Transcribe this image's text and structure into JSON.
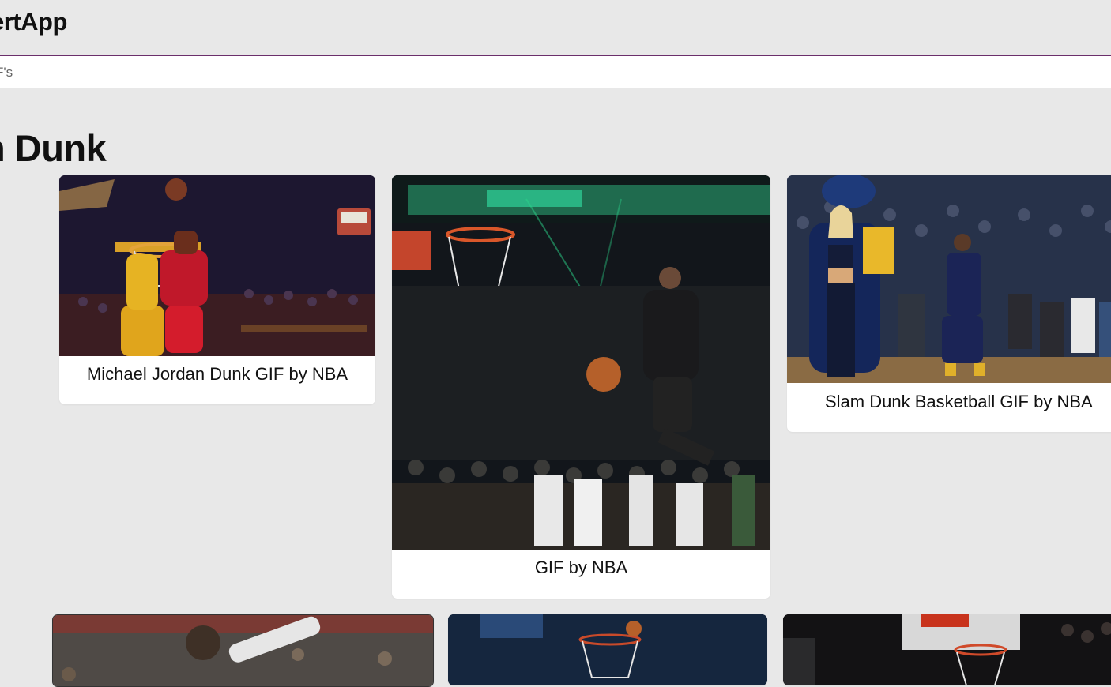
{
  "app": {
    "title": "ertApp"
  },
  "search": {
    "placeholder": "F's"
  },
  "section": {
    "title": "n Dunk"
  },
  "cards": [
    {
      "caption": "Michael Jordan Dunk GIF by NBA"
    },
    {
      "caption": "GIF by NBA"
    },
    {
      "caption": "Slam Dunk Basketball GIF by NBA"
    },
    {
      "caption": ""
    },
    {
      "caption": ""
    },
    {
      "caption": ""
    }
  ],
  "colors": {
    "background": "#e8e8e8",
    "search_border": "#6b2f6b",
    "card": "#ffffff"
  }
}
